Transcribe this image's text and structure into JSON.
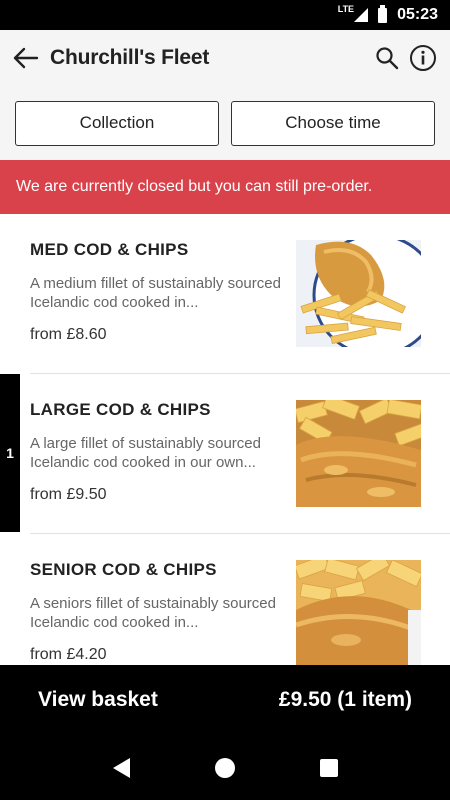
{
  "status_bar": {
    "network": "LTE",
    "time": "05:23"
  },
  "app_bar": {
    "title": "Churchill's Fleet",
    "back_icon": "arrow-left-icon",
    "search_icon": "search-icon",
    "info_icon": "info-icon"
  },
  "actions": {
    "collection_label": "Collection",
    "choose_time_label": "Choose time"
  },
  "banner": {
    "text": "We are currently closed but you can still pre-order.",
    "color": "#d9424a"
  },
  "menu": {
    "items": [
      {
        "name": "MED COD & CHIPS",
        "description": "A medium fillet of sustainably sourced Icelandic cod cooked in...",
        "price": "from £8.60",
        "quantity": null
      },
      {
        "name": "LARGE COD & CHIPS",
        "description": "A large fillet of sustainably sourced Icelandic cod cooked in our own...",
        "price": "from £9.50",
        "quantity": "1"
      },
      {
        "name": "SENIOR COD & CHIPS",
        "description": "A seniors fillet of sustainably sourced Icelandic cod cooked in...",
        "price": "from £4.20",
        "quantity": null
      }
    ]
  },
  "basket": {
    "label": "View basket",
    "total": "£9.50 (1 item)"
  }
}
